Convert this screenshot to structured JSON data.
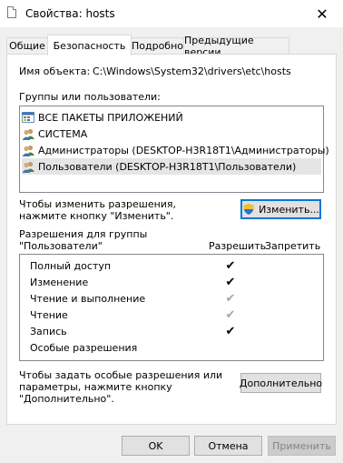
{
  "window": {
    "title": "Свойства: hosts",
    "close_symbol": "✕"
  },
  "tabs": [
    {
      "label": "Общие"
    },
    {
      "label": "Безопасность"
    },
    {
      "label": "Подробно"
    },
    {
      "label": "Предыдущие версии"
    }
  ],
  "object": {
    "label": "Имя объекта:",
    "value": "C:\\Windows\\System32\\drivers\\etc\\hosts"
  },
  "groups": {
    "label": "Группы или пользователи:",
    "items": [
      {
        "label": "ВСЕ ПАКЕТЫ ПРИЛОЖЕНИЙ",
        "icon": "app-packages-icon",
        "selected": false
      },
      {
        "label": "СИСТЕМА",
        "icon": "users-icon",
        "selected": false
      },
      {
        "label": "Администраторы (DESKTOP-H3R18T1\\Администраторы)",
        "icon": "users-icon",
        "selected": false
      },
      {
        "label": "Пользователи (DESKTOP-H3R18T1\\Пользователи)",
        "icon": "users-icon",
        "selected": true
      }
    ]
  },
  "change": {
    "text_line1": "Чтобы изменить разрешения,",
    "text_line2": "нажмите кнопку \"Изменить\".",
    "button": "Изменить...",
    "button_icon": "uac-shield-icon"
  },
  "permissions": {
    "title_line1": "Разрешения для группы",
    "title_line2": "\"Пользователи\"",
    "allow_header": "Разрешить",
    "deny_header": "Запретить",
    "rows": [
      {
        "label": "Полный доступ",
        "allow": true,
        "inherited": false
      },
      {
        "label": "Изменение",
        "allow": true,
        "inherited": false
      },
      {
        "label": "Чтение и выполнение",
        "allow": true,
        "inherited": true
      },
      {
        "label": "Чтение",
        "allow": true,
        "inherited": true
      },
      {
        "label": "Запись",
        "allow": true,
        "inherited": false
      },
      {
        "label": "Особые разрешения",
        "allow": false,
        "inherited": false
      }
    ]
  },
  "advanced": {
    "text_line1": "Чтобы задать особые разрешения или",
    "text_line2": "параметры, нажмите кнопку",
    "text_line3": "\"Дополнительно\".",
    "button": "Дополнительно"
  },
  "footer": {
    "ok": "OK",
    "cancel": "Отмена",
    "apply": "Применить"
  },
  "colors": {
    "accent": "#0078d7",
    "check_active": "#000000",
    "check_inherited": "#a6a6a6"
  }
}
